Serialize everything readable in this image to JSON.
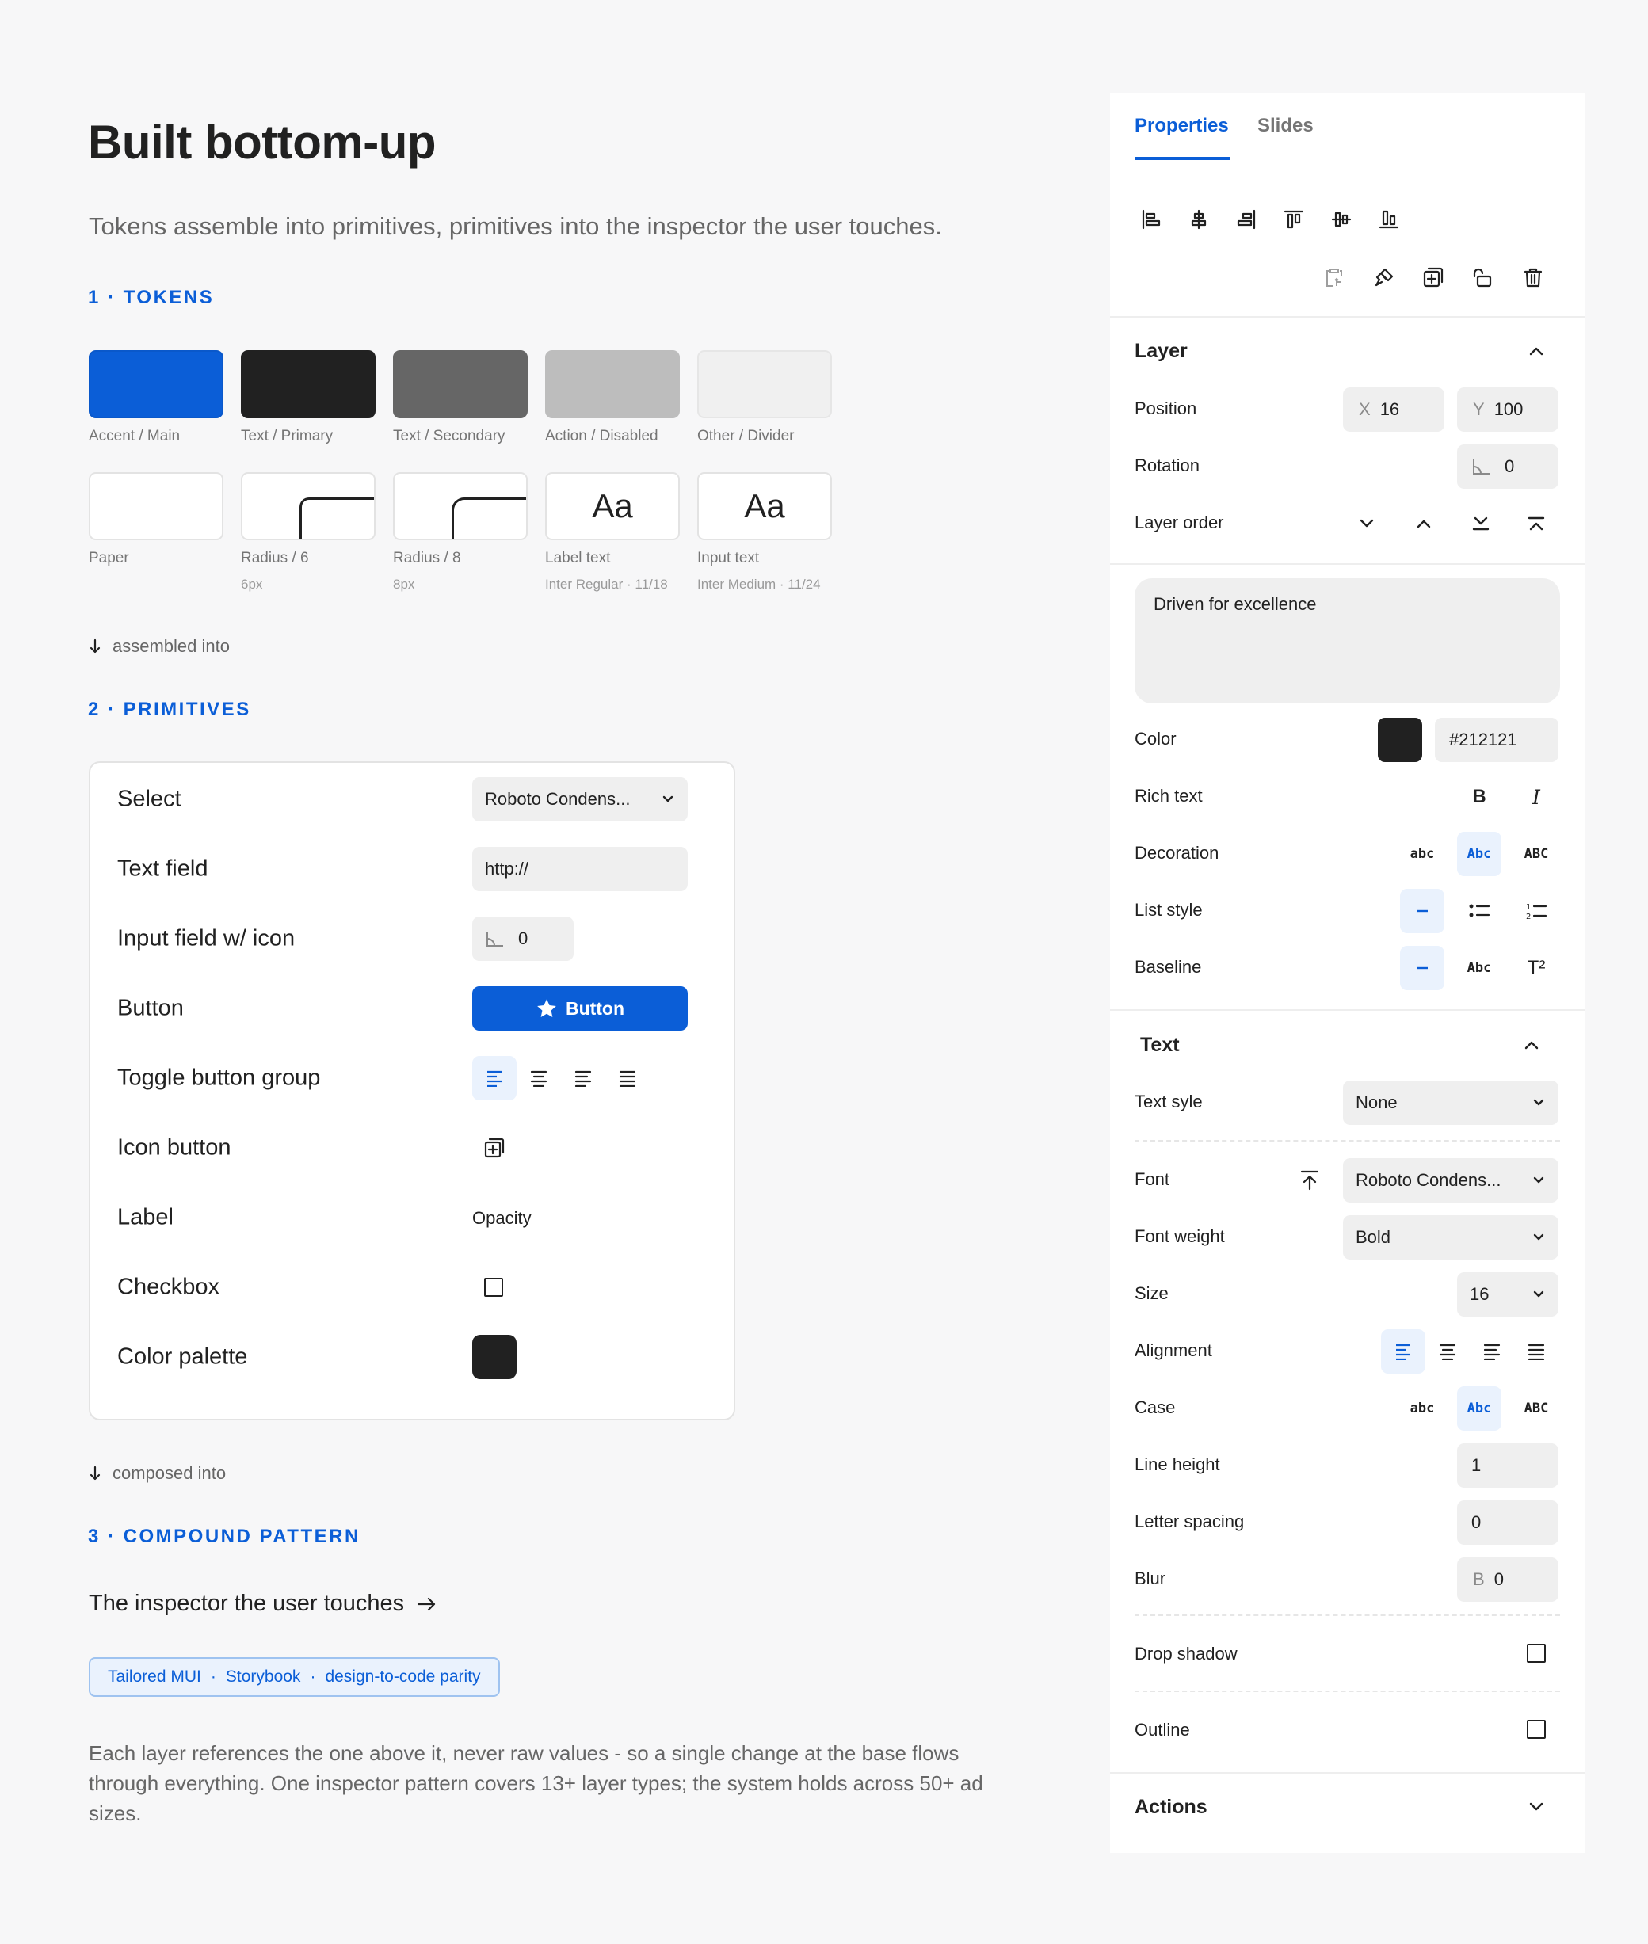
{
  "page": {
    "title": "Built bottom-up",
    "subtitle": "Tokens assemble into primitives, primitives into the inspector the user touches."
  },
  "tokens": {
    "heading": "1 · TOKENS",
    "colors": [
      {
        "label": "Accent / Main",
        "color": "#0b5ed7"
      },
      {
        "label": "Text / Primary",
        "color": "#212121"
      },
      {
        "label": "Text / Secondary",
        "color": "#666666"
      },
      {
        "label": "Action / Disabled",
        "color": "#bdbdbd"
      },
      {
        "label": "Other / Divider",
        "color": "#f0f0f0"
      }
    ],
    "others": [
      {
        "label": "Paper",
        "sub": ""
      },
      {
        "label": "Radius / 6",
        "sub": "6px"
      },
      {
        "label": "Radius / 8",
        "sub": "8px"
      },
      {
        "label": "Label text",
        "sub": "Inter Regular · 11/18",
        "sample": "Aa"
      },
      {
        "label": "Input text",
        "sub": "Inter Medium · 11/24",
        "sample": "Aa"
      }
    ],
    "note": "assembled into"
  },
  "primitives": {
    "heading": "2 · PRIMITIVES",
    "rows": [
      {
        "label": "Select",
        "value": "Roboto Condens..."
      },
      {
        "label": "Text field",
        "value": "http://"
      },
      {
        "label": "Input field w/ icon",
        "value": "0"
      },
      {
        "label": "Button",
        "value": "Button"
      },
      {
        "label": "Toggle button group"
      },
      {
        "label": "Icon button"
      },
      {
        "label": "Label",
        "value": "Opacity"
      },
      {
        "label": "Checkbox"
      },
      {
        "label": "Color palette",
        "color": "#212121"
      }
    ],
    "note": "composed into"
  },
  "compound": {
    "heading": "3 · COMPOUND PATTERN",
    "link": "The inspector the user touches",
    "tags": [
      "Tailored MUI",
      "·",
      "Storybook",
      "·",
      "design-to-code parity"
    ],
    "body": "Each layer references the one above it, never raw values - so a single change at the base flows through everything. One inspector pattern covers 13+ layer types; the system holds across 50+ ad sizes."
  },
  "panel": {
    "tabs": [
      {
        "label": "Properties",
        "active": true
      },
      {
        "label": "Slides",
        "active": false
      }
    ],
    "layer": {
      "title": "Layer",
      "position_label": "Position",
      "x_prefix": "X",
      "x": "16",
      "y_prefix": "Y",
      "y": "100",
      "rotation_label": "Rotation",
      "rotation": "0",
      "order_label": "Layer order"
    },
    "text_content": "Driven for excellence",
    "color_label": "Color",
    "color_value": "#212121",
    "rich_text_label": "Rich text",
    "bold": "B",
    "italic": "I",
    "decoration_label": "Decoration",
    "decoration_options": [
      "abc",
      "Abc",
      "ABC"
    ],
    "list_style_label": "List style",
    "baseline_label": "Baseline",
    "baseline_abc": "Abc",
    "baseline_sup": "T²",
    "text_section": {
      "title": "Text",
      "text_style_label": "Text syle",
      "text_style": "None",
      "font_label": "Font",
      "font": "Roboto Condens...",
      "weight_label": "Font weight",
      "weight": "Bold",
      "size_label": "Size",
      "size": "16",
      "alignment_label": "Alignment",
      "case_label": "Case",
      "case_options": [
        "abc",
        "Abc",
        "ABC"
      ],
      "line_height_label": "Line height",
      "line_height": "1",
      "letter_spacing_label": "Letter spacing",
      "letter_spacing": "0",
      "blur_label": "Blur",
      "blur_prefix": "B",
      "blur": "0",
      "drop_shadow_label": "Drop shadow",
      "outline_label": "Outline"
    },
    "actions_title": "Actions"
  }
}
